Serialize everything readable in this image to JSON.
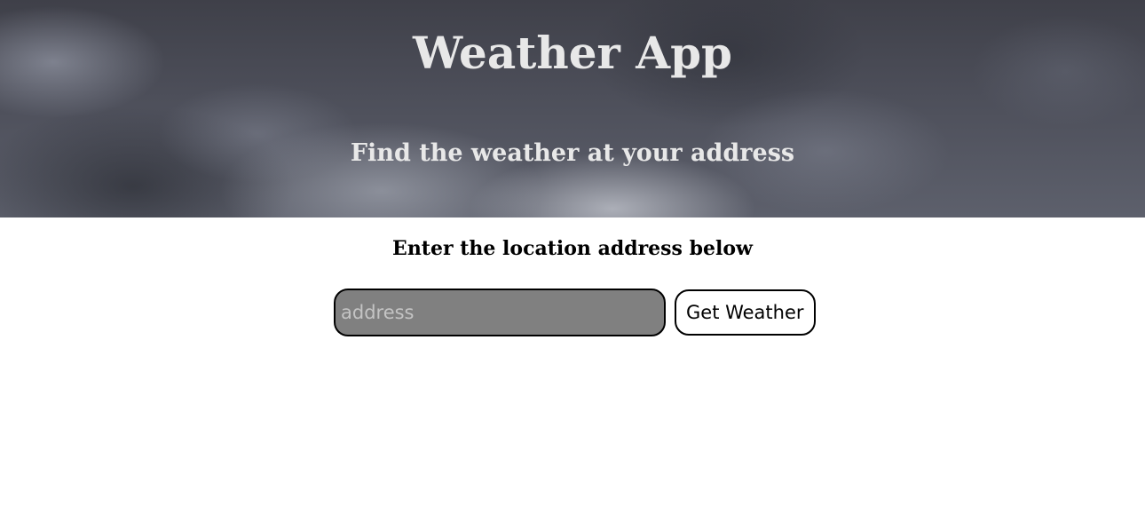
{
  "header": {
    "title": "Weather App",
    "subtitle": "Find the weather at your address"
  },
  "main": {
    "prompt": "Enter the location address below",
    "address_input": {
      "placeholder": "address",
      "value": ""
    },
    "submit_label": "Get Weather"
  },
  "colors": {
    "input_background": "#808080",
    "header_text": "#e8e8e8",
    "border": "#000000"
  }
}
